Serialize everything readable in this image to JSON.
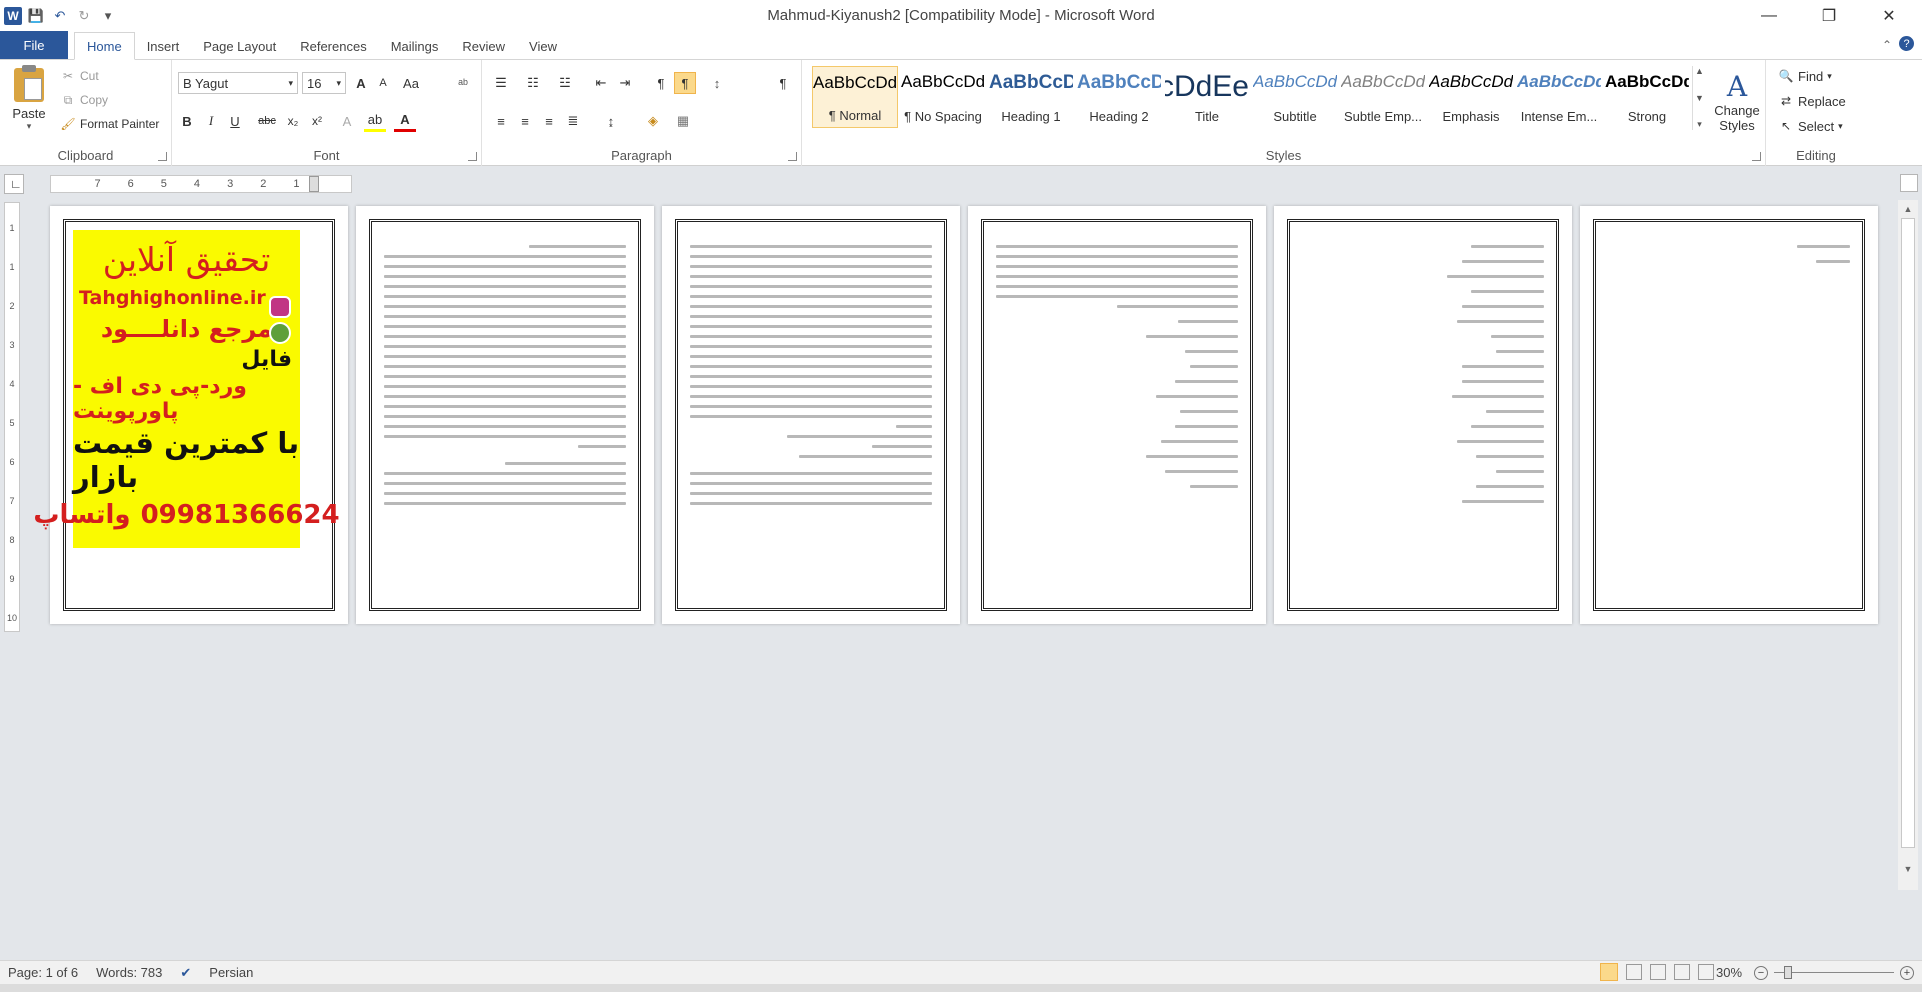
{
  "window": {
    "title": "Mahmud-Kiyanush2 [Compatibility Mode]  -  Microsoft Word",
    "minimize": "—",
    "restore": "❐",
    "close": "✕",
    "help": "?"
  },
  "qat": {
    "save": "💾",
    "undo": "↶",
    "redo": "↻",
    "customize": "▾"
  },
  "tabs": [
    "File",
    "Home",
    "Insert",
    "Page Layout",
    "References",
    "Mailings",
    "Review",
    "View"
  ],
  "clipboard": {
    "paste": "Paste",
    "cut": "Cut",
    "copy": "Copy",
    "format_painter": "Format Painter",
    "label": "Clipboard"
  },
  "font": {
    "family": "B Yagut",
    "size": "16",
    "label": "Font",
    "bold": "B",
    "italic": "I",
    "underline": "U",
    "strike": "abc",
    "sub": "x₂",
    "sup": "x²",
    "grow": "A",
    "shrink": "A",
    "case": "Aa",
    "highlight": "ab",
    "color": "A",
    "effects": "A",
    "clear": "ᵃᵇ"
  },
  "paragraph": {
    "label": "Paragraph"
  },
  "styles": {
    "label": "Styles",
    "items": [
      {
        "preview": "AaBbCcDdEe",
        "name": "¶ Normal",
        "selected": true
      },
      {
        "preview": "AaBbCcDdEe",
        "name": "¶ No Spacing"
      },
      {
        "preview": "AaBbCcDdEe",
        "name": "Heading 1"
      },
      {
        "preview": "AaBbCcDdEe",
        "name": "Heading 2"
      },
      {
        "preview": "AaBbCcDdEe",
        "name": "Title"
      },
      {
        "preview": "AaBbCcDdEe",
        "name": "Subtitle"
      },
      {
        "preview": "AaBbCcDdEe",
        "name": "Subtle Emp..."
      },
      {
        "preview": "AaBbCcDdEe",
        "name": "Emphasis"
      },
      {
        "preview": "AaBbCcDdEe",
        "name": "Intense Em..."
      },
      {
        "preview": "AaBbCcDdEe",
        "name": "Strong"
      }
    ],
    "change_styles": "Change Styles"
  },
  "editing": {
    "find": "Find",
    "replace": "Replace",
    "select": "Select",
    "label": "Editing"
  },
  "ruler": {
    "numbers": [
      "7",
      "6",
      "5",
      "4",
      "3",
      "2",
      "1"
    ],
    "vnumbers": [
      "1",
      "1",
      "2",
      "3",
      "4",
      "5",
      "6",
      "7",
      "8",
      "9",
      "10"
    ]
  },
  "ad": {
    "line1": "تحقیق آنلاین",
    "line2": "Tahghighonline.ir",
    "line3": "مرجع دانلــــود",
    "line4": "فایل",
    "line5": "ورد-پی دی اف - پاورپوینت",
    "line6": "با کمترین قیمت بازار",
    "phone": "09981366624",
    "whatsapp": "واتساپ"
  },
  "status": {
    "page": "Page: 1 of 6",
    "words": "Words: 783",
    "language": "Persian",
    "zoom": "30%"
  },
  "colors": {
    "accent": "#2b579a",
    "ad_bg": "#fafa00",
    "ad_red": "#d41f1f"
  }
}
